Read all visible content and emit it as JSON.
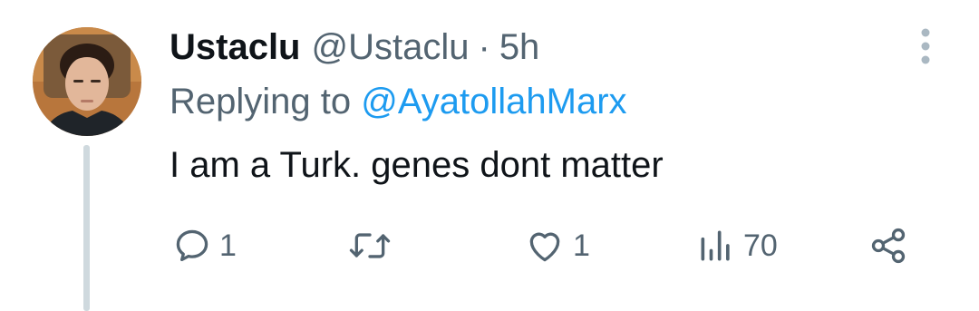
{
  "tweet": {
    "display_name": "Ustaclu",
    "handle": "@Ustaclu",
    "separator": "·",
    "time": "5h",
    "reply_prefix": "Replying to ",
    "reply_mention": "@AyatollahMarx",
    "text": "I am a Turk. genes dont matter"
  },
  "actions": {
    "reply": {
      "icon": "reply-icon",
      "count": "1"
    },
    "retweet": {
      "icon": "retweet-icon",
      "count": ""
    },
    "like": {
      "icon": "heart-icon",
      "count": "1"
    },
    "views": {
      "icon": "views-icon",
      "count": "70"
    },
    "share": {
      "icon": "share-icon"
    }
  },
  "colors": {
    "text_primary": "#0f1419",
    "text_secondary": "#536471",
    "link": "#1d9bf0",
    "thread_line": "#cfd9de",
    "more_dots": "#aab8c2"
  }
}
